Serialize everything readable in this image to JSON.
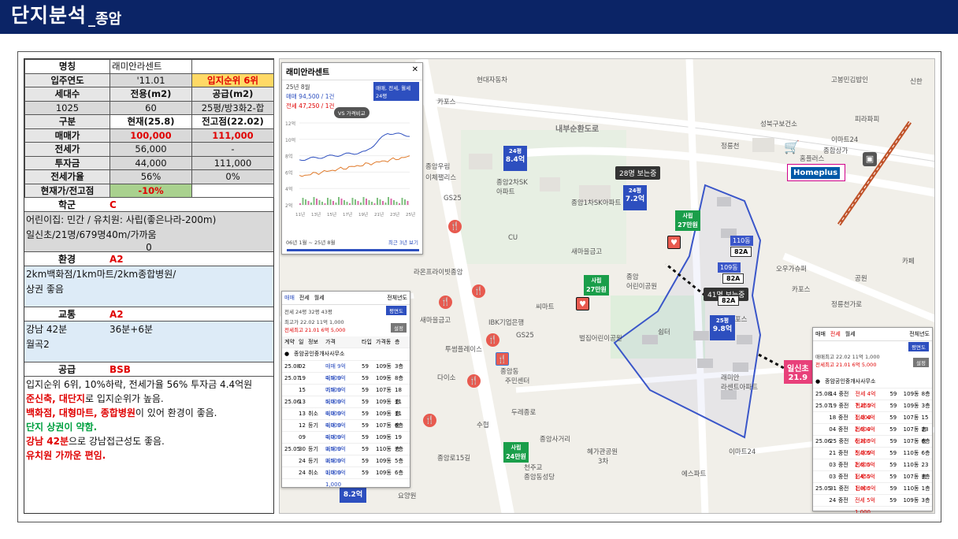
{
  "header": {
    "title": "단지분석",
    "subtitle": "_종암"
  },
  "info": {
    "name_label": "명칭",
    "name_value": "래미안라센트",
    "year_label": "입주연도",
    "year_value": "'11.01",
    "rank": "입지순위 6위",
    "units_label": "세대수",
    "area_label": "전용(m2)",
    "supply_label": "공급(m2)",
    "units_value": "1025",
    "area_value": "60",
    "supply_value": "25평/방3화2-합",
    "type_label": "구분",
    "current_label": "현재(25.8)",
    "peak_label": "전고점(22.02)",
    "sale_label": "매매가",
    "sale_current": "100,000",
    "sale_peak": "111,000",
    "jeonse_label": "전세가",
    "jeonse_current": "56,000",
    "jeonse_peak": "-",
    "invest_label": "투자금",
    "invest_current": "44,000",
    "invest_peak": "111,000",
    "ratio_label": "전세가율",
    "ratio_current": "56%",
    "ratio_peak": "0%",
    "vs_label": "현재가/전고점",
    "vs_value": "-10%"
  },
  "school": {
    "label": "학군",
    "grade": "C",
    "line1": "어린이집: 민간 / 유치원: 사립(좋은나라-200m)",
    "line2": "일신초/21명/679명40m/가까움",
    "line3": "0"
  },
  "env": {
    "label": "환경",
    "grade": "A2",
    "line1": "2km백화점/1km마트/2km종합병원/",
    "line2": "상권 좋음"
  },
  "traffic": {
    "label": "교통",
    "grade": "A2",
    "line1a": "강남 42분",
    "line1b": "36분+6분",
    "line2": "월곡2"
  },
  "supply": {
    "label": "공급",
    "grade": "BSB",
    "line1": "입지순위 6위, 10%하락, 전세가율 56% 투자금 4.4억원",
    "line2a": "준신축, 대단지",
    "line2b": "로 입지순위가 높음.",
    "line3a": "백화점, 대형마트, 종합병원",
    "line3b": "이 있어 환경이 좋음.",
    "line4": "단지 상권이 약함.",
    "line5a": "강남 42분",
    "line5b": "으로 강남접근성도 좋음.",
    "line6": "유치원 가까운 편임."
  },
  "map": {
    "road": "내부순환도로",
    "labels": [
      "오패산로17길",
      "현대자동차",
      "카포스",
      "고봉민김밥인",
      "성북구보건소",
      "정릉천",
      "이마트24",
      "피라파피",
      "종합상가",
      "홈플러스",
      "Homeplus",
      "종암우림",
      "이체팰리스",
      "종암2차SK",
      "아파트",
      "종암1차SK아파트",
      "GS25",
      "CU",
      "새마을금고",
      "라온프라이빗종암",
      "씨마트",
      "IBK기업은행",
      "새마을금고",
      "투썸플레이스",
      "종암동",
      "주민센터",
      "다이소",
      "두레종로",
      "GS25",
      "수협",
      "종암사거리",
      "카포스",
      "오우가슈퍼",
      "카포스",
      "정릉천가로",
      "공원",
      "래미안",
      "라센트아파트",
      "벌집어린이공원",
      "종암",
      "어린이공원",
      "쉼터",
      "혜가관공원",
      "3차",
      "이마트24",
      "에스파트",
      "천주교",
      "종암동성당",
      "종암로15길",
      "요양원",
      "세란아이마트",
      "카페",
      "신한"
    ],
    "marker_8_4": "8.4억",
    "marker_8_4_top": "24평",
    "marker_7_2": "7.2억",
    "marker_7_2_top": "24평",
    "marker_9_8": "9.8억",
    "marker_9_8_top": "25평",
    "marker_8_2": "8.2억",
    "tag_28": "28명 보는중",
    "tag_41": "41명 보는중",
    "sale1": "27만원",
    "sale1_top": "사립",
    "sale2": "27만원",
    "sale2_top": "사립",
    "sale3": "24만원",
    "sale3_top": "사립",
    "unit_110": "110동",
    "unit_82a": "82A",
    "unit_109": "109동",
    "unit_82a_2": "82A",
    "unit_82a_3": "82A",
    "station": "일신초",
    "station_num": "21.9"
  },
  "panel1": {
    "title": "래미안라센트",
    "date": "25년 8월",
    "sale": "매매 94,500 / 1건",
    "jeonse": "전세 47,250 / 1건",
    "box_label": "매매, 전세, 월세",
    "box_sub": "24평",
    "btn": "VS 가격비교",
    "ylabels": [
      "12억",
      "10억",
      "8억",
      "6억",
      "4억",
      "2억"
    ],
    "xlabels": [
      "11년",
      "13년",
      "15년",
      "17년",
      "19년",
      "21년",
      "23년",
      "25년"
    ],
    "range": "06년 1월 ~ 25년 8월",
    "recent": "최근 3년 보기"
  },
  "panel2": {
    "tabs": [
      "매매",
      "전세",
      "월세"
    ],
    "period": "전체년도",
    "row1": "전세 24평 32평 43평",
    "btn": "평면도",
    "peak": "최고가 22.02 11억 1,000",
    "low": "전세최고 21.01 6억 5,000",
    "btn2": "설정",
    "cols": [
      "계약",
      "일",
      "정보",
      "가격",
      "타입",
      "가격동",
      "층"
    ],
    "agent": "종암공인중개사사무소",
    "rows": [
      [
        "25.08",
        "02",
        "",
        "매매 9억 4,500",
        "59",
        "109동",
        "3층"
      ],
      [
        "25.07",
        "19",
        "",
        "매매 9억 7,500",
        "59",
        "109동",
        "8층"
      ],
      [
        "",
        "15",
        "",
        "매매 9억 5,000",
        "59",
        "107동",
        "18층"
      ],
      [
        "25.06",
        "13",
        "",
        "매매 9억 4,000",
        "59",
        "109동",
        "11층"
      ],
      [
        "",
        "13",
        "취소",
        "매매 9억 4,000",
        "59",
        "109동",
        "11층"
      ],
      [
        "",
        "12",
        "등기",
        "매매 9억 4,000",
        "59",
        "107동",
        "6층"
      ],
      [
        "",
        "09",
        "",
        "매매 9억 3,500",
        "59",
        "109동",
        "19층"
      ],
      [
        "25.05",
        "30",
        "등기",
        "매매 9억 3,500",
        "59",
        "110동",
        "7층"
      ],
      [
        "",
        "24",
        "등기",
        "매매 9억 1,000",
        "59",
        "109동",
        "5층"
      ],
      [
        "",
        "24",
        "취소",
        "매매 9억 1,000",
        "59",
        "109동",
        "6층"
      ]
    ]
  },
  "panel3": {
    "tabs": [
      "매매",
      "전세",
      "월세"
    ],
    "period": "전체년도",
    "btn": "평면도",
    "peak": "매매최고 22.02 11억 1,000",
    "low": "전세최고 21.01 6억 5,000",
    "btn2": "설정",
    "agent": "종암공인중개사사무소",
    "rows": [
      [
        "25.08",
        "14",
        "중전",
        "전세 4억 7,250",
        "59",
        "109동",
        "8층"
      ],
      [
        "25.07",
        "19",
        "중전",
        "전세 5억 1,000",
        "59",
        "109동",
        "3층"
      ],
      [
        "",
        "18",
        "중전",
        "전세 4억 2,000",
        "59",
        "107동",
        "15층"
      ],
      [
        "",
        "04",
        "중전",
        "전세 4억 6,200",
        "59",
        "107동",
        "23층"
      ],
      [
        "25.06",
        "25",
        "중전",
        "전세 5억 5,000",
        "59",
        "107동",
        "6층"
      ],
      [
        "",
        "21",
        "중전",
        "전세 5억 2,000",
        "59",
        "110동",
        "6층"
      ],
      [
        "",
        "03",
        "중전",
        "전세 5억 1,450",
        "59",
        "110동",
        "23층"
      ],
      [
        "",
        "03",
        "중전",
        "전세 5억 1,000",
        "59",
        "107동",
        "3층"
      ],
      [
        "25.05",
        "31",
        "중전",
        "전세 5억",
        "59",
        "110동",
        "1층"
      ],
      [
        "",
        "24",
        "중전",
        "전세 5억 1,000",
        "59",
        "109동",
        "3층"
      ]
    ]
  }
}
